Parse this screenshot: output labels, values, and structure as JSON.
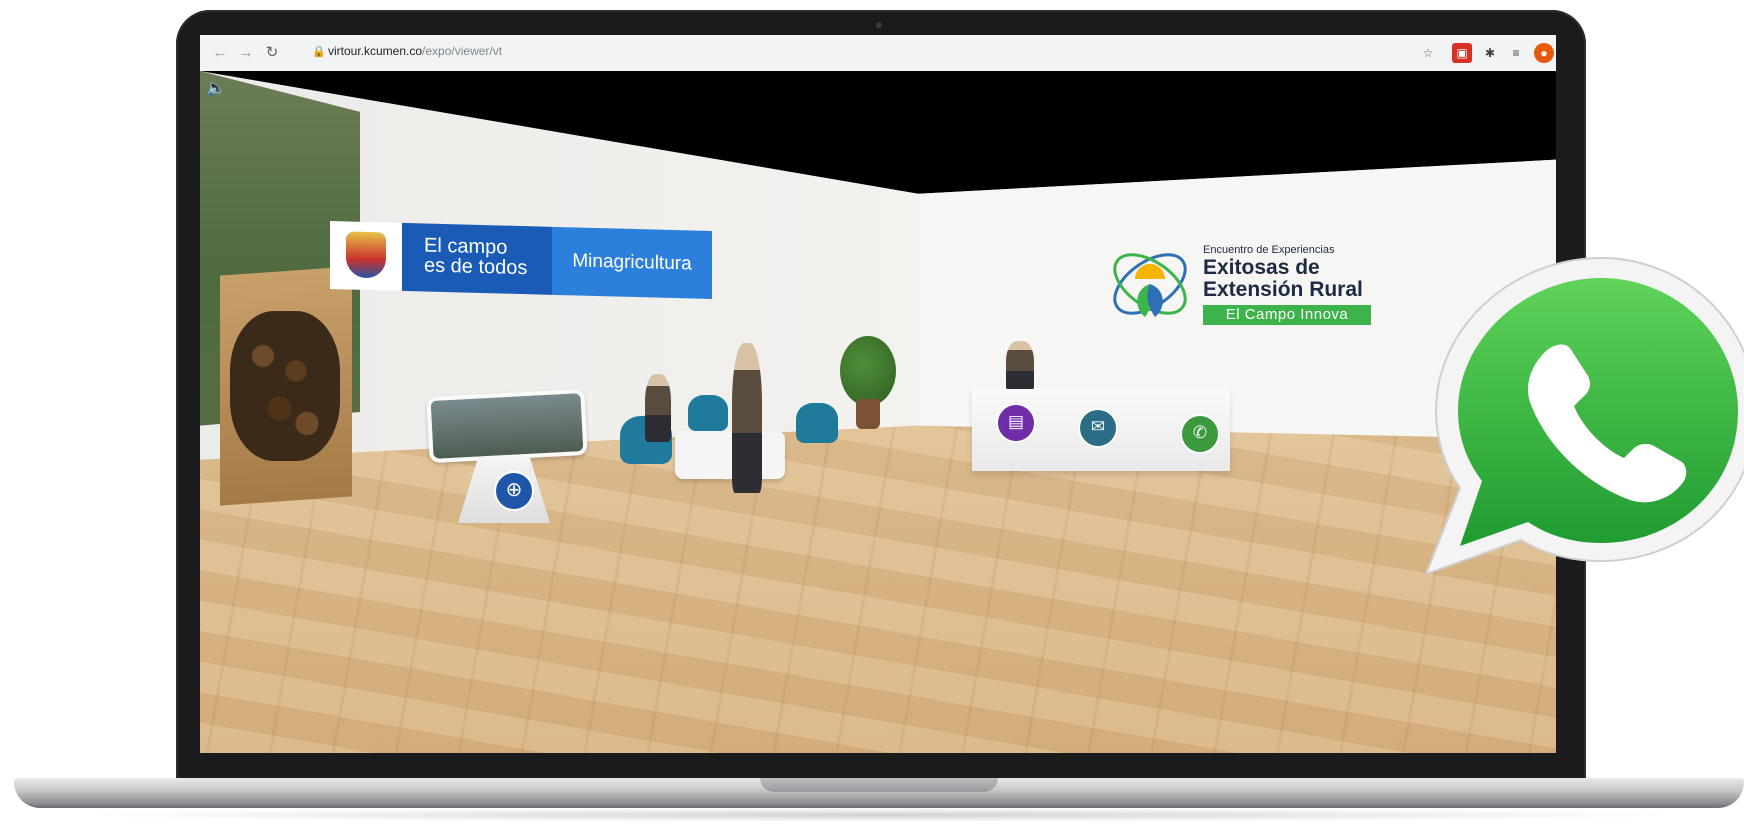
{
  "browser": {
    "url_host": "virtour.kcumen.co",
    "url_path": "/expo/viewer/vt",
    "icons": [
      "back-icon",
      "forward-icon",
      "reload-icon",
      "lock-icon",
      "star-icon",
      "extension-icon",
      "puzzle-icon",
      "media-icon",
      "profile-icon"
    ]
  },
  "scene": {
    "banner": {
      "line1": "El campo",
      "line2": "es de todos",
      "ministry": "Minagricultura"
    },
    "expo_logo": {
      "kicker": "Encuentro de Experiencias",
      "title_line1": "Exitosas de",
      "title_line2": "Extensión Rural",
      "tagline": "El Campo Innova"
    },
    "hotspots": [
      "globe-icon",
      "pdf-icon",
      "chat-icon",
      "whatsapp-icon"
    ]
  },
  "colors": {
    "whatsapp_green": "#2fb24a",
    "banner_blue": "#1a5bb5",
    "tag_green": "#3cb44b"
  }
}
